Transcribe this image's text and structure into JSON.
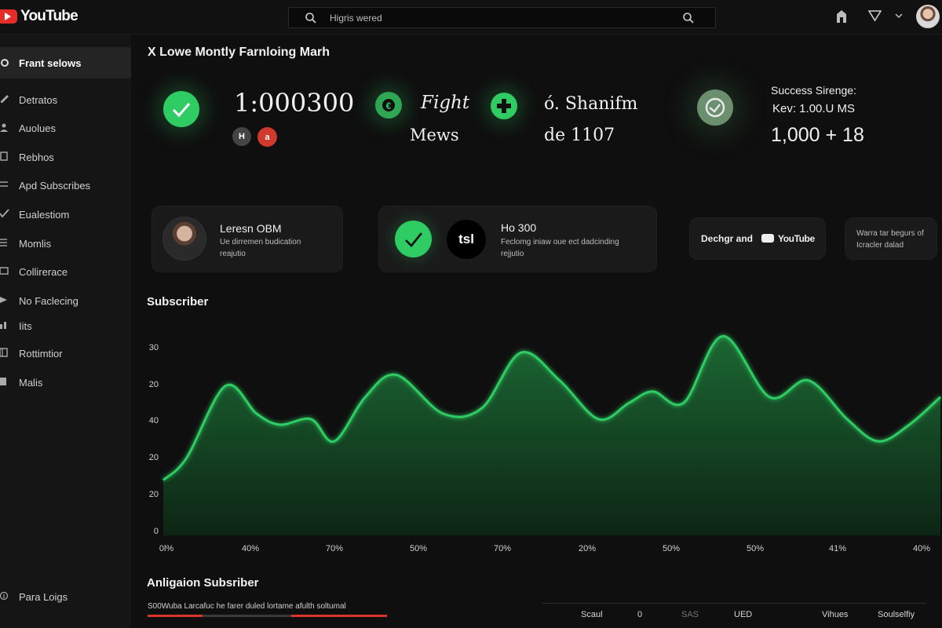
{
  "app": {
    "name": "YouTube"
  },
  "search": {
    "placeholder": "Higris wered"
  },
  "sidebar": {
    "items": [
      {
        "label": "Frant selows",
        "icon": "gear-icon",
        "active": true
      },
      {
        "label": "Detratos",
        "icon": "pencil-icon"
      },
      {
        "label": "Auolues",
        "icon": "person-icon"
      },
      {
        "label": "Rebhos",
        "icon": "document-icon"
      },
      {
        "label": "Apd Subscribes",
        "icon": "list-icon"
      },
      {
        "label": "Eualestiom",
        "icon": "check-icon"
      },
      {
        "label": "Momlis",
        "icon": "menu-icon"
      },
      {
        "label": "Collirerace",
        "icon": "folder-icon"
      },
      {
        "label": "No Faclecing",
        "icon": "star-icon"
      },
      {
        "label": "Iits",
        "icon": "bars-icon"
      },
      {
        "label": "Rottimtior",
        "icon": "book-icon"
      },
      {
        "label": "Malis",
        "icon": "doc-icon"
      }
    ],
    "footer_label": "Para Loigs"
  },
  "header": {
    "title": "X Lowe Montly Farnloing Marh"
  },
  "stats": {
    "main_value": "1:000300",
    "badge_left": "H",
    "badge_right": "a",
    "fight_label": "Fight",
    "mews_label": "Mews",
    "shanifm_label": "ó. Shanifm",
    "de_label": "de 1107",
    "success_title": "Success Sirenge:",
    "success_sub": "Kev: 1.00.U MS",
    "success_value": "1,000 + 18"
  },
  "cards": {
    "profile": {
      "title": "Leresn OBM",
      "sub1": "Ue dirremen budication",
      "sub2": "reajutio"
    },
    "middle": {
      "badge": "tsl",
      "title": "Ho 300",
      "sub1": "Feclomg iniaw oue ect dadcinding",
      "sub2": "rejjutio"
    },
    "design": {
      "label": "Dechgr and",
      "brand": "YouTube"
    },
    "note": {
      "line1": "Warra tar begurs of",
      "line2": "Icracler dalad"
    }
  },
  "chart_section": {
    "title": "Subscriber"
  },
  "chart_data": {
    "type": "area",
    "title": "Subscriber",
    "y_ticks": [
      "30",
      "20",
      "40",
      "20",
      "20",
      "0"
    ],
    "x_ticks": [
      "0l%",
      "40%",
      "70%",
      "50%",
      "70%",
      "20%",
      "50%",
      "50%",
      "41%",
      "40%"
    ],
    "series": [
      {
        "values": [
          [
            0.0,
            10
          ],
          [
            0.03,
            14
          ],
          [
            0.08,
            27
          ],
          [
            0.12,
            22
          ],
          [
            0.15,
            20
          ],
          [
            0.19,
            21
          ],
          [
            0.22,
            17
          ],
          [
            0.26,
            25
          ],
          [
            0.3,
            29
          ],
          [
            0.36,
            22
          ],
          [
            0.41,
            23
          ],
          [
            0.46,
            33
          ],
          [
            0.51,
            28
          ],
          [
            0.56,
            21
          ],
          [
            0.6,
            24
          ],
          [
            0.63,
            26
          ],
          [
            0.67,
            24
          ],
          [
            0.72,
            36
          ],
          [
            0.78,
            25
          ],
          [
            0.83,
            28
          ],
          [
            0.88,
            21
          ],
          [
            0.92,
            17
          ],
          [
            0.96,
            20
          ],
          [
            1.0,
            25
          ]
        ]
      }
    ],
    "color": "#2ecc62",
    "fill": "#123a20"
  },
  "bottom": {
    "title": "Anligaion Subsriber",
    "text": "S00Wuba Larcafuc he farer duled lortame afulth soltumal",
    "columns": [
      "Scaul",
      "0",
      "SAS",
      "UED",
      "Vihues",
      "Soulselfiy"
    ]
  }
}
